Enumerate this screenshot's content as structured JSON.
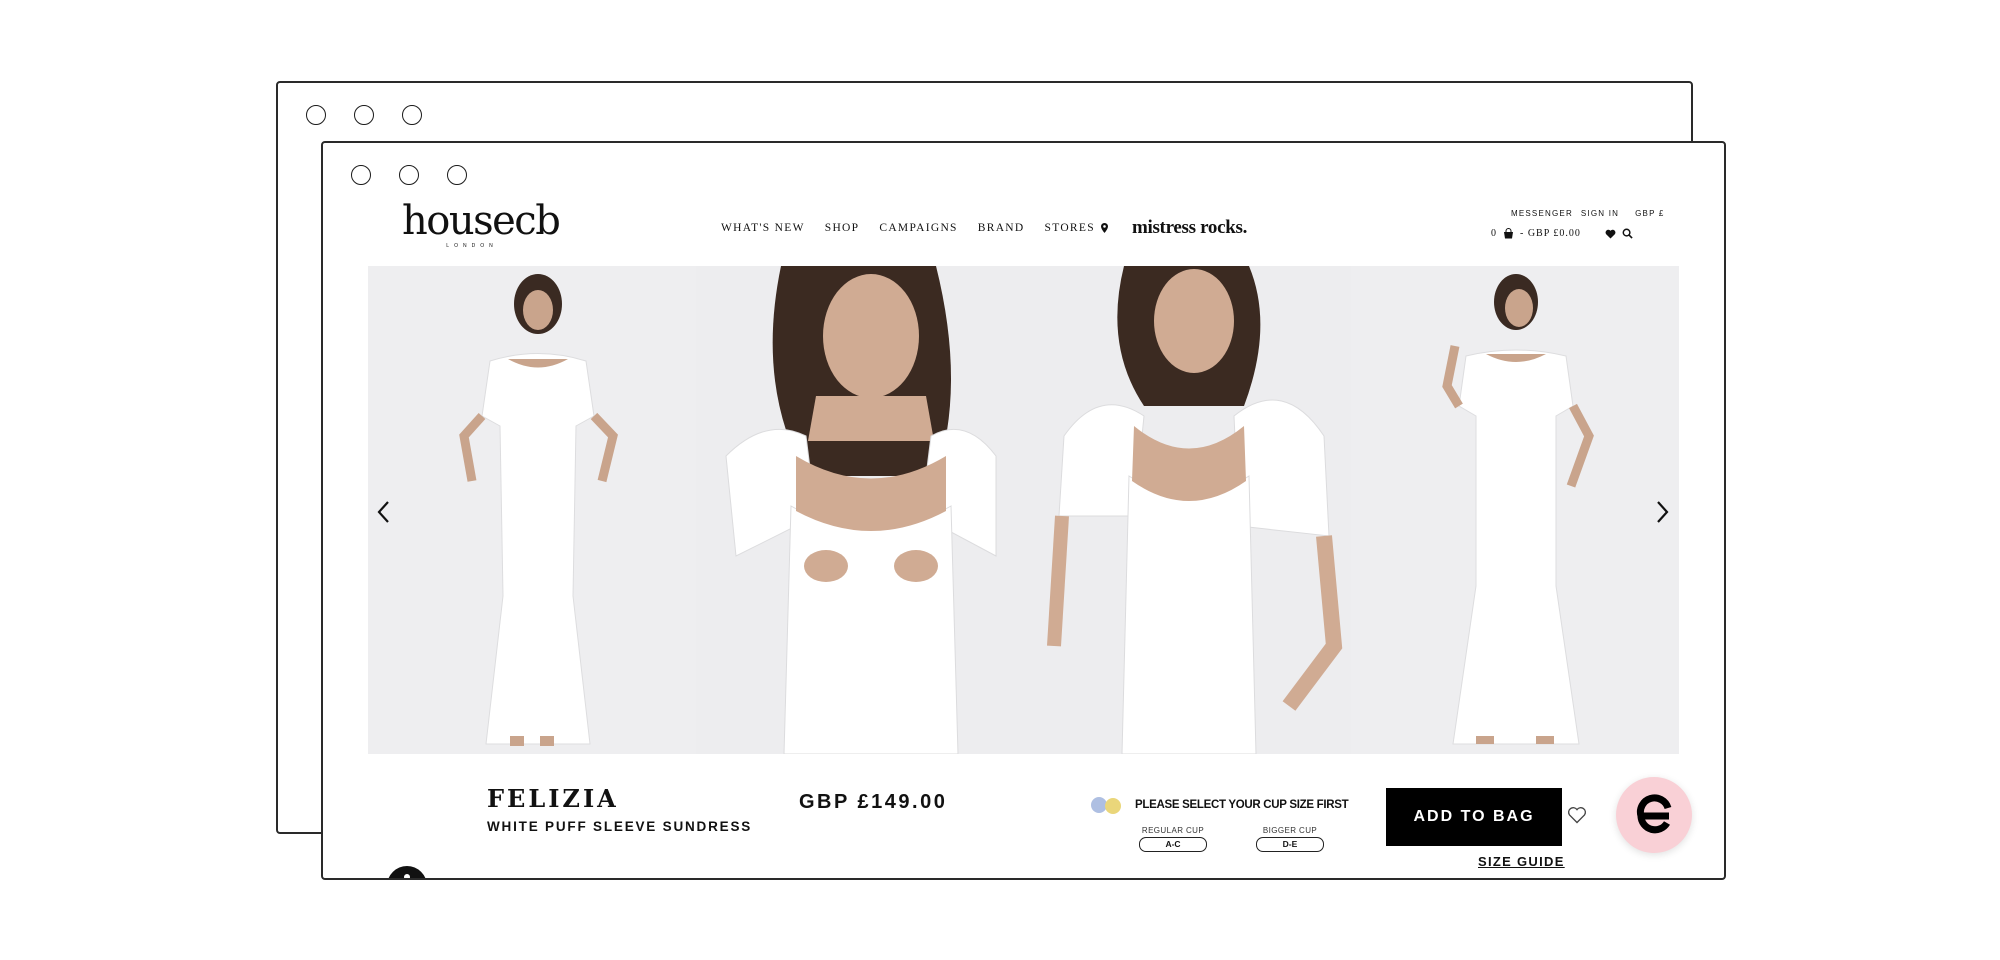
{
  "header": {
    "logo_main": "housecb",
    "logo_sub": "LONDON",
    "nav": [
      "WHAT'S NEW",
      "SHOP",
      "CAMPAIGNS",
      "BRAND",
      "STORES"
    ],
    "brand_link": "mistress rocks.",
    "util_top": [
      "MESSENGER",
      "SIGN IN",
      "GBP £"
    ],
    "bag_count": "0",
    "bag_total": "- GBP £0.00"
  },
  "product": {
    "name": "FELIZIA",
    "subtitle": "WHITE PUFF SLEEVE SUNDRESS",
    "price": "GBP £149.00",
    "cup_prompt": "PLEASE SELECT YOUR CUP SIZE FIRST",
    "cups": [
      {
        "label": "REGULAR CUP",
        "value": "A-C"
      },
      {
        "label": "BIGGER CUP",
        "value": "D-E"
      }
    ],
    "add_to_bag": "ADD TO BAG",
    "size_guide": "SIZE GUIDE"
  },
  "gallery": {
    "images": [
      "model-full-length-front",
      "model-bust-closeup",
      "model-side-closeup",
      "model-full-length-pose"
    ]
  },
  "icons": [
    "location-pin-icon",
    "bag-icon",
    "heart-icon",
    "search-icon",
    "chevron-left-icon",
    "chevron-right-icon",
    "wishlist-heart-icon",
    "chat-icon",
    "accessibility-icon"
  ],
  "colors": {
    "accent": "#000000",
    "chat_bubble": "#f9d0d6",
    "photo_bg": "#ececee"
  }
}
